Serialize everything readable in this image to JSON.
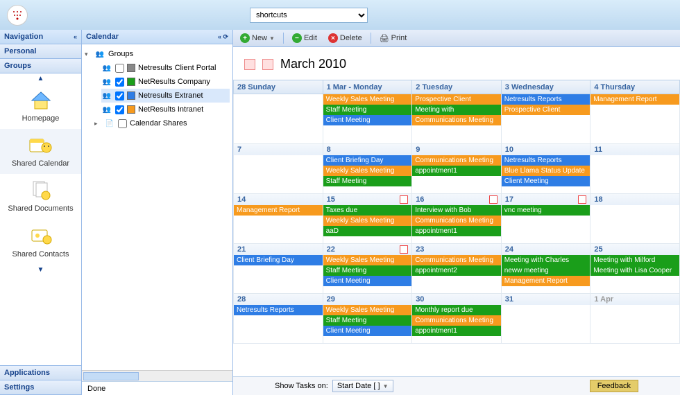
{
  "header": {
    "shortcuts_label": "shortcuts"
  },
  "sidebar": {
    "title": "Navigation",
    "sections": {
      "personal": "Personal",
      "groups": "Groups",
      "applications": "Applications",
      "settings": "Settings"
    },
    "apps": [
      {
        "label": "Homepage"
      },
      {
        "label": "Shared Calendar"
      },
      {
        "label": "Shared Documents"
      },
      {
        "label": "Shared Contacts"
      }
    ]
  },
  "tree": {
    "title": "Calendar",
    "root": "Groups",
    "items": [
      {
        "label": "Netresults Client Portal",
        "color": "#888888",
        "checked": false
      },
      {
        "label": "NetResults Company",
        "color": "#1a9e1a",
        "checked": true
      },
      {
        "label": "Netresults Extranet",
        "color": "#2e7de5",
        "checked": true
      },
      {
        "label": "NetResults Intranet",
        "color": "#f79a1e",
        "checked": true
      }
    ],
    "shares": "Calendar Shares"
  },
  "toolbar": {
    "new": "New",
    "edit": "Edit",
    "delete": "Delete",
    "print": "Print"
  },
  "calendar": {
    "title": "March 2010",
    "columns": [
      "28 Sunday",
      "1 Mar - Monday",
      "2 Tuesday",
      "3 Wednesday",
      "4 Thursday"
    ],
    "weeks": [
      {
        "days": [
          {
            "num": "28",
            "other": true,
            "greenish": true,
            "events": []
          },
          {
            "num": "1 Mar - Monday",
            "isHeader": true,
            "events": [
              {
                "t": "Weekly Sales Meeting",
                "c": "orange"
              },
              {
                "t": "Staff Meeting",
                "c": "green"
              },
              {
                "t": "Client Meeting",
                "c": "blue"
              }
            ]
          },
          {
            "num": "2",
            "events": [
              {
                "t": "Prospective Client",
                "c": "orange"
              },
              {
                "t": "Meeting with",
                "c": "green"
              },
              {
                "t": "Communications Meeting",
                "c": "orange"
              }
            ]
          },
          {
            "num": "3",
            "events": [
              {
                "t": "Netresults Reports",
                "c": "blue"
              },
              {
                "t": "Prospective Client",
                "c": "orange"
              }
            ]
          },
          {
            "num": "4",
            "events": [
              {
                "t": "Management Report",
                "c": "orange"
              }
            ]
          }
        ]
      },
      {
        "days": [
          {
            "num": "7",
            "events": []
          },
          {
            "num": "8",
            "events": [
              {
                "t": "Client Briefing Day",
                "c": "blue"
              },
              {
                "t": "Weekly Sales Meeting",
                "c": "orange"
              },
              {
                "t": "Staff Meeting",
                "c": "green"
              }
            ]
          },
          {
            "num": "9",
            "events": [
              {
                "t": "Communications Meeting",
                "c": "orange"
              },
              {
                "t": "appointment1",
                "c": "green"
              }
            ]
          },
          {
            "num": "10",
            "events": [
              {
                "t": "Netresults Reports",
                "c": "blue"
              },
              {
                "t": "Blue Llama Status Update",
                "c": "orange"
              },
              {
                "t": "Client Meeting",
                "c": "blue"
              }
            ]
          },
          {
            "num": "11",
            "events": []
          }
        ]
      },
      {
        "days": [
          {
            "num": "14",
            "events": [
              {
                "t": "Management Report",
                "c": "orange"
              }
            ]
          },
          {
            "num": "15",
            "ink": true,
            "events": [
              {
                "t": "Taxes due",
                "c": "green"
              },
              {
                "t": "Weekly Sales Meeting",
                "c": "orange"
              },
              {
                "t": "aaD",
                "c": "green"
              }
            ]
          },
          {
            "num": "16",
            "ink": true,
            "events": [
              {
                "t": "Interview with Bob",
                "c": "green"
              },
              {
                "t": "Communications Meeting",
                "c": "orange"
              },
              {
                "t": "appointment1",
                "c": "green"
              }
            ]
          },
          {
            "num": "17",
            "ink": true,
            "events": [
              {
                "t": "vnc meeting",
                "c": "green"
              }
            ]
          },
          {
            "num": "18",
            "events": []
          }
        ]
      },
      {
        "days": [
          {
            "num": "21",
            "events": [
              {
                "t": "Client Briefing Day",
                "c": "blue"
              }
            ]
          },
          {
            "num": "22",
            "ink": true,
            "events": [
              {
                "t": "Weekly Sales Meeting",
                "c": "orange"
              },
              {
                "t": "Staff Meeting",
                "c": "green"
              },
              {
                "t": "Client Meeting",
                "c": "blue"
              }
            ]
          },
          {
            "num": "23",
            "events": [
              {
                "t": "Communications Meeting",
                "c": "orange"
              },
              {
                "t": "appointment2",
                "c": "green"
              }
            ]
          },
          {
            "num": "24",
            "events": [
              {
                "t": "Meeting with Charles",
                "c": "green"
              },
              {
                "t": "neww meeting",
                "c": "green"
              },
              {
                "t": "Management Report",
                "c": "orange"
              }
            ]
          },
          {
            "num": "25",
            "pinkish": true,
            "events": [
              {
                "t": "Meeting with Milford",
                "c": "green"
              },
              {
                "t": "Meeting with Lisa Cooper",
                "c": "green"
              }
            ]
          }
        ]
      },
      {
        "days": [
          {
            "num": "28",
            "events": [
              {
                "t": "Netresults Reports",
                "c": "blue"
              }
            ]
          },
          {
            "num": "29",
            "events": [
              {
                "t": "Weekly Sales Meeting",
                "c": "orange"
              },
              {
                "t": "Staff Meeting",
                "c": "green"
              },
              {
                "t": "Client Meeting",
                "c": "blue"
              }
            ]
          },
          {
            "num": "30",
            "events": [
              {
                "t": "Monthly report due",
                "c": "green"
              },
              {
                "t": "Communications Meeting",
                "c": "orange"
              },
              {
                "t": "appointment1",
                "c": "green"
              }
            ]
          },
          {
            "num": "31",
            "events": []
          },
          {
            "num": "1 Apr",
            "other": true,
            "events": []
          }
        ]
      }
    ]
  },
  "tasks": {
    "label": "Show Tasks on:",
    "selector": "Start Date [ ]"
  },
  "status": {
    "done": "Done",
    "feedback": "Feedback"
  }
}
